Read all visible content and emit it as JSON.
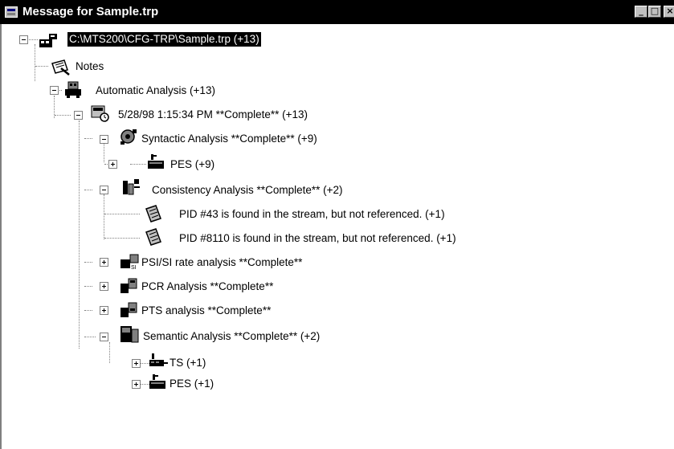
{
  "window": {
    "title": "Message for Sample.trp",
    "controls": {
      "minimize": "_",
      "maximize": "□",
      "close": "×"
    }
  },
  "tree": {
    "root": "C:\\MTS200\\CFG-TRP\\Sample.trp (+13)",
    "notes": "Notes",
    "auto": "Automatic Analysis (+13)",
    "run": "5/28/98 1:15:34 PM **Complete** (+13)",
    "syntactic": "Syntactic Analysis **Complete** (+9)",
    "syn_pes": "PES (+9)",
    "consistency": "Consistency Analysis **Complete** (+2)",
    "pid43": "PID #43 is found in the stream, but not referenced. (+1)",
    "pid8110": "PID #8110 is found in the stream, but not referenced. (+1)",
    "psi": "PSI/SI rate analysis **Complete**",
    "pcr": "PCR Analysis **Complete**",
    "pts": "PTS analysis **Complete**",
    "semantic": "Semantic Analysis **Complete** (+2)",
    "sem_ts": "TS (+1)",
    "sem_pes": "PES (+1)"
  },
  "icons": {
    "root": "file-trace-icon",
    "notes": "notes-icon",
    "auto": "automatic-analysis-icon",
    "run": "analysis-run-icon",
    "syntactic": "syntactic-analysis-icon",
    "pes": "pes-icon",
    "consistency": "consistency-analysis-icon",
    "pid": "pid-message-icon",
    "psi": "psi-si-analysis-icon",
    "pcr": "pcr-analysis-icon",
    "pts": "pts-analysis-icon",
    "semantic": "semantic-analysis-icon",
    "ts": "ts-icon"
  },
  "colors": {
    "titlebar": "#000000",
    "background": "#ffffff",
    "selection": "#000000"
  }
}
